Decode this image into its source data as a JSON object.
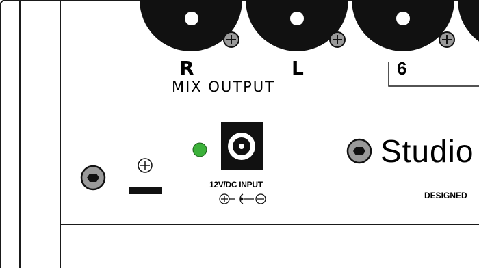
{
  "panel": {
    "mix_right_label": "R",
    "mix_left_label": "L",
    "mix_output_label": "MIX OUTPUT",
    "channel_number": "6",
    "dc_input_label": "12V/DC INPUT",
    "brand_text": "Studio",
    "designed_text": "DESIGNED"
  },
  "colors": {
    "led": "#3cb13a",
    "panel_line": "#1a1a1a",
    "jack_body": "#111111",
    "screw_fill": "#9a9a9a"
  }
}
